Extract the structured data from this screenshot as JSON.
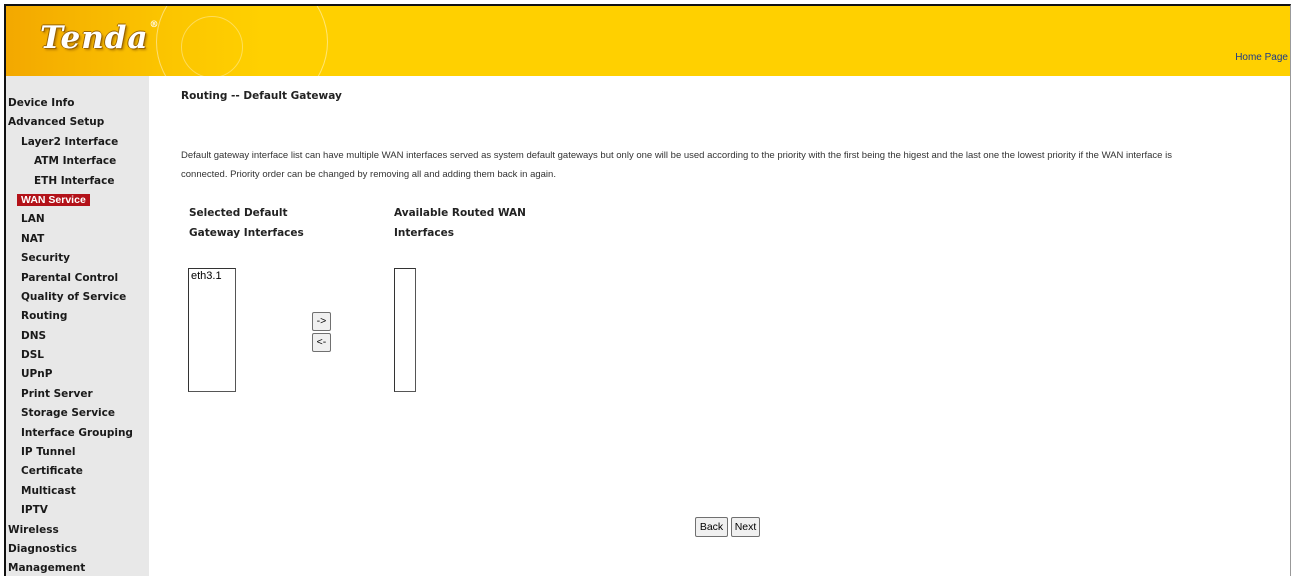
{
  "header": {
    "logo": "Tenda",
    "logo_mark": "®",
    "home_link": "Home Page"
  },
  "sidebar": {
    "items": [
      {
        "label": "Device Info",
        "level": 0
      },
      {
        "label": "Advanced Setup",
        "level": 0
      },
      {
        "label": "Layer2 Interface",
        "level": 1
      },
      {
        "label": "ATM Interface",
        "level": 2
      },
      {
        "label": "ETH Interface",
        "level": 2
      },
      {
        "label": "WAN Service",
        "level": 1,
        "active": true
      },
      {
        "label": "LAN",
        "level": 1
      },
      {
        "label": "NAT",
        "level": 1
      },
      {
        "label": "Security",
        "level": 1
      },
      {
        "label": "Parental Control",
        "level": 1
      },
      {
        "label": "Quality of Service",
        "level": 1
      },
      {
        "label": "Routing",
        "level": 1
      },
      {
        "label": "DNS",
        "level": 1
      },
      {
        "label": "DSL",
        "level": 1
      },
      {
        "label": "UPnP",
        "level": 1
      },
      {
        "label": "Print Server",
        "level": 1
      },
      {
        "label": "Storage Service",
        "level": 1
      },
      {
        "label": "Interface Grouping",
        "level": 1
      },
      {
        "label": "IP Tunnel",
        "level": 1
      },
      {
        "label": "Certificate",
        "level": 1
      },
      {
        "label": "Multicast",
        "level": 1
      },
      {
        "label": "IPTV",
        "level": 1
      },
      {
        "label": "Wireless",
        "level": 0
      },
      {
        "label": "Diagnostics",
        "level": 0
      },
      {
        "label": "Management",
        "level": 0
      }
    ]
  },
  "main": {
    "title": "Routing -- Default Gateway",
    "description_line1": "Default gateway interface list can have multiple WAN interfaces served as system default gateways but only one will be used according to the priority with the first being the higest and the last one the lowest priority if the WAN interface is",
    "description_line2": "connected. Priority order can be changed by removing all and adding them back in again.",
    "selected_head_1": "Selected Default",
    "selected_head_2": "Gateway Interfaces",
    "available_head_1": "Available Routed WAN",
    "available_head_2": "Interfaces",
    "selected_options": [
      "eth3.1"
    ],
    "available_options": [],
    "move_right_label": "->",
    "move_left_label": "<-",
    "back_label": "Back",
    "next_label": "Next"
  },
  "colors": {
    "header": "#ffd000",
    "active_item": "#b31219",
    "sidebar_bg": "#e8e8e8"
  }
}
